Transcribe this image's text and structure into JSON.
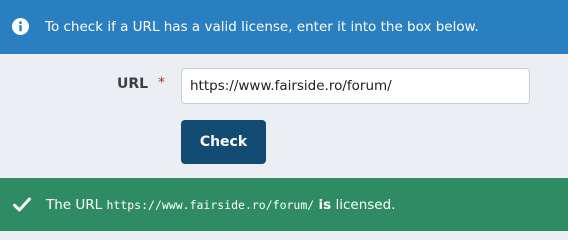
{
  "info_banner": {
    "icon": "info-circle-icon",
    "text": "To check if a URL has a valid license, enter it into the box below.",
    "color": "#2a7fc0"
  },
  "form": {
    "url_label": "URL",
    "required_marker": "*",
    "url_value": "https://www.fairside.ro/forum/",
    "check_label": "Check",
    "button_color": "#144b72"
  },
  "result": {
    "icon": "checkmark-icon",
    "prefix": "The URL",
    "url": "https://www.fairside.ro/forum/",
    "is_word": "is",
    "suffix": "licensed.",
    "color": "#2e8b64"
  }
}
